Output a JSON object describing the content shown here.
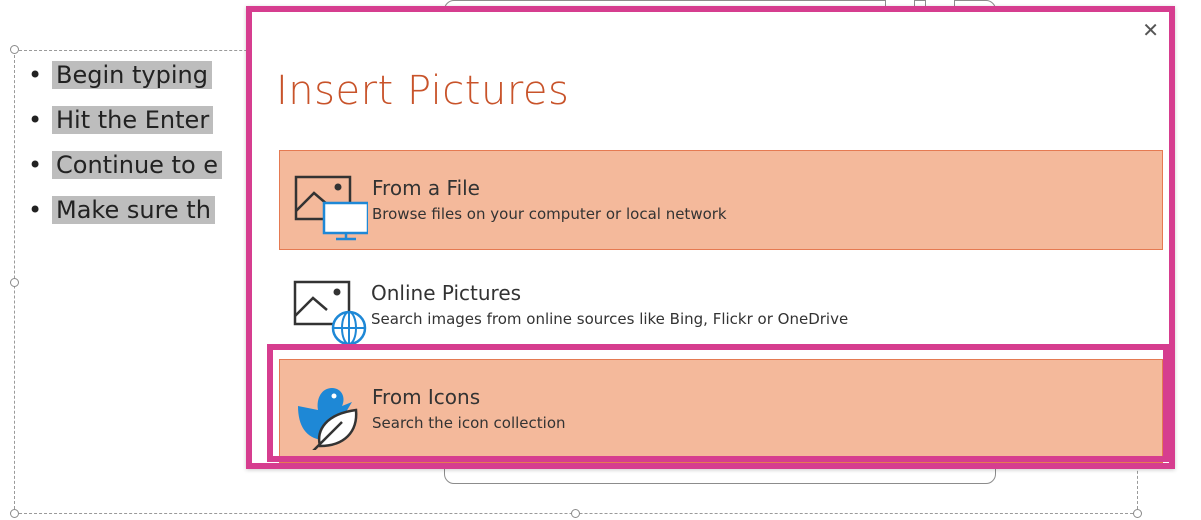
{
  "slide": {
    "bullets": [
      "Begin typing",
      "Hit the Enter",
      "Continue to e",
      "Make sure th"
    ]
  },
  "dialog": {
    "title": "Insert Pictures",
    "close_glyph": "✕",
    "options": [
      {
        "title": "From a File",
        "description": "Browse files on your computer or local network",
        "icon": "picture-computer-icon"
      },
      {
        "title": "Online Pictures",
        "description": "Search images from online sources like Bing, Flickr or OneDrive",
        "icon": "picture-globe-icon"
      },
      {
        "title": "From Icons",
        "description": "Search the icon collection",
        "icon": "bird-leaf-icon"
      }
    ]
  },
  "colors": {
    "title": "#c8532a",
    "highlight_border": "#d63d8f",
    "option_fill": "#f4b99b",
    "option_border": "#e57a52",
    "icon_blue": "#1e88d6"
  }
}
